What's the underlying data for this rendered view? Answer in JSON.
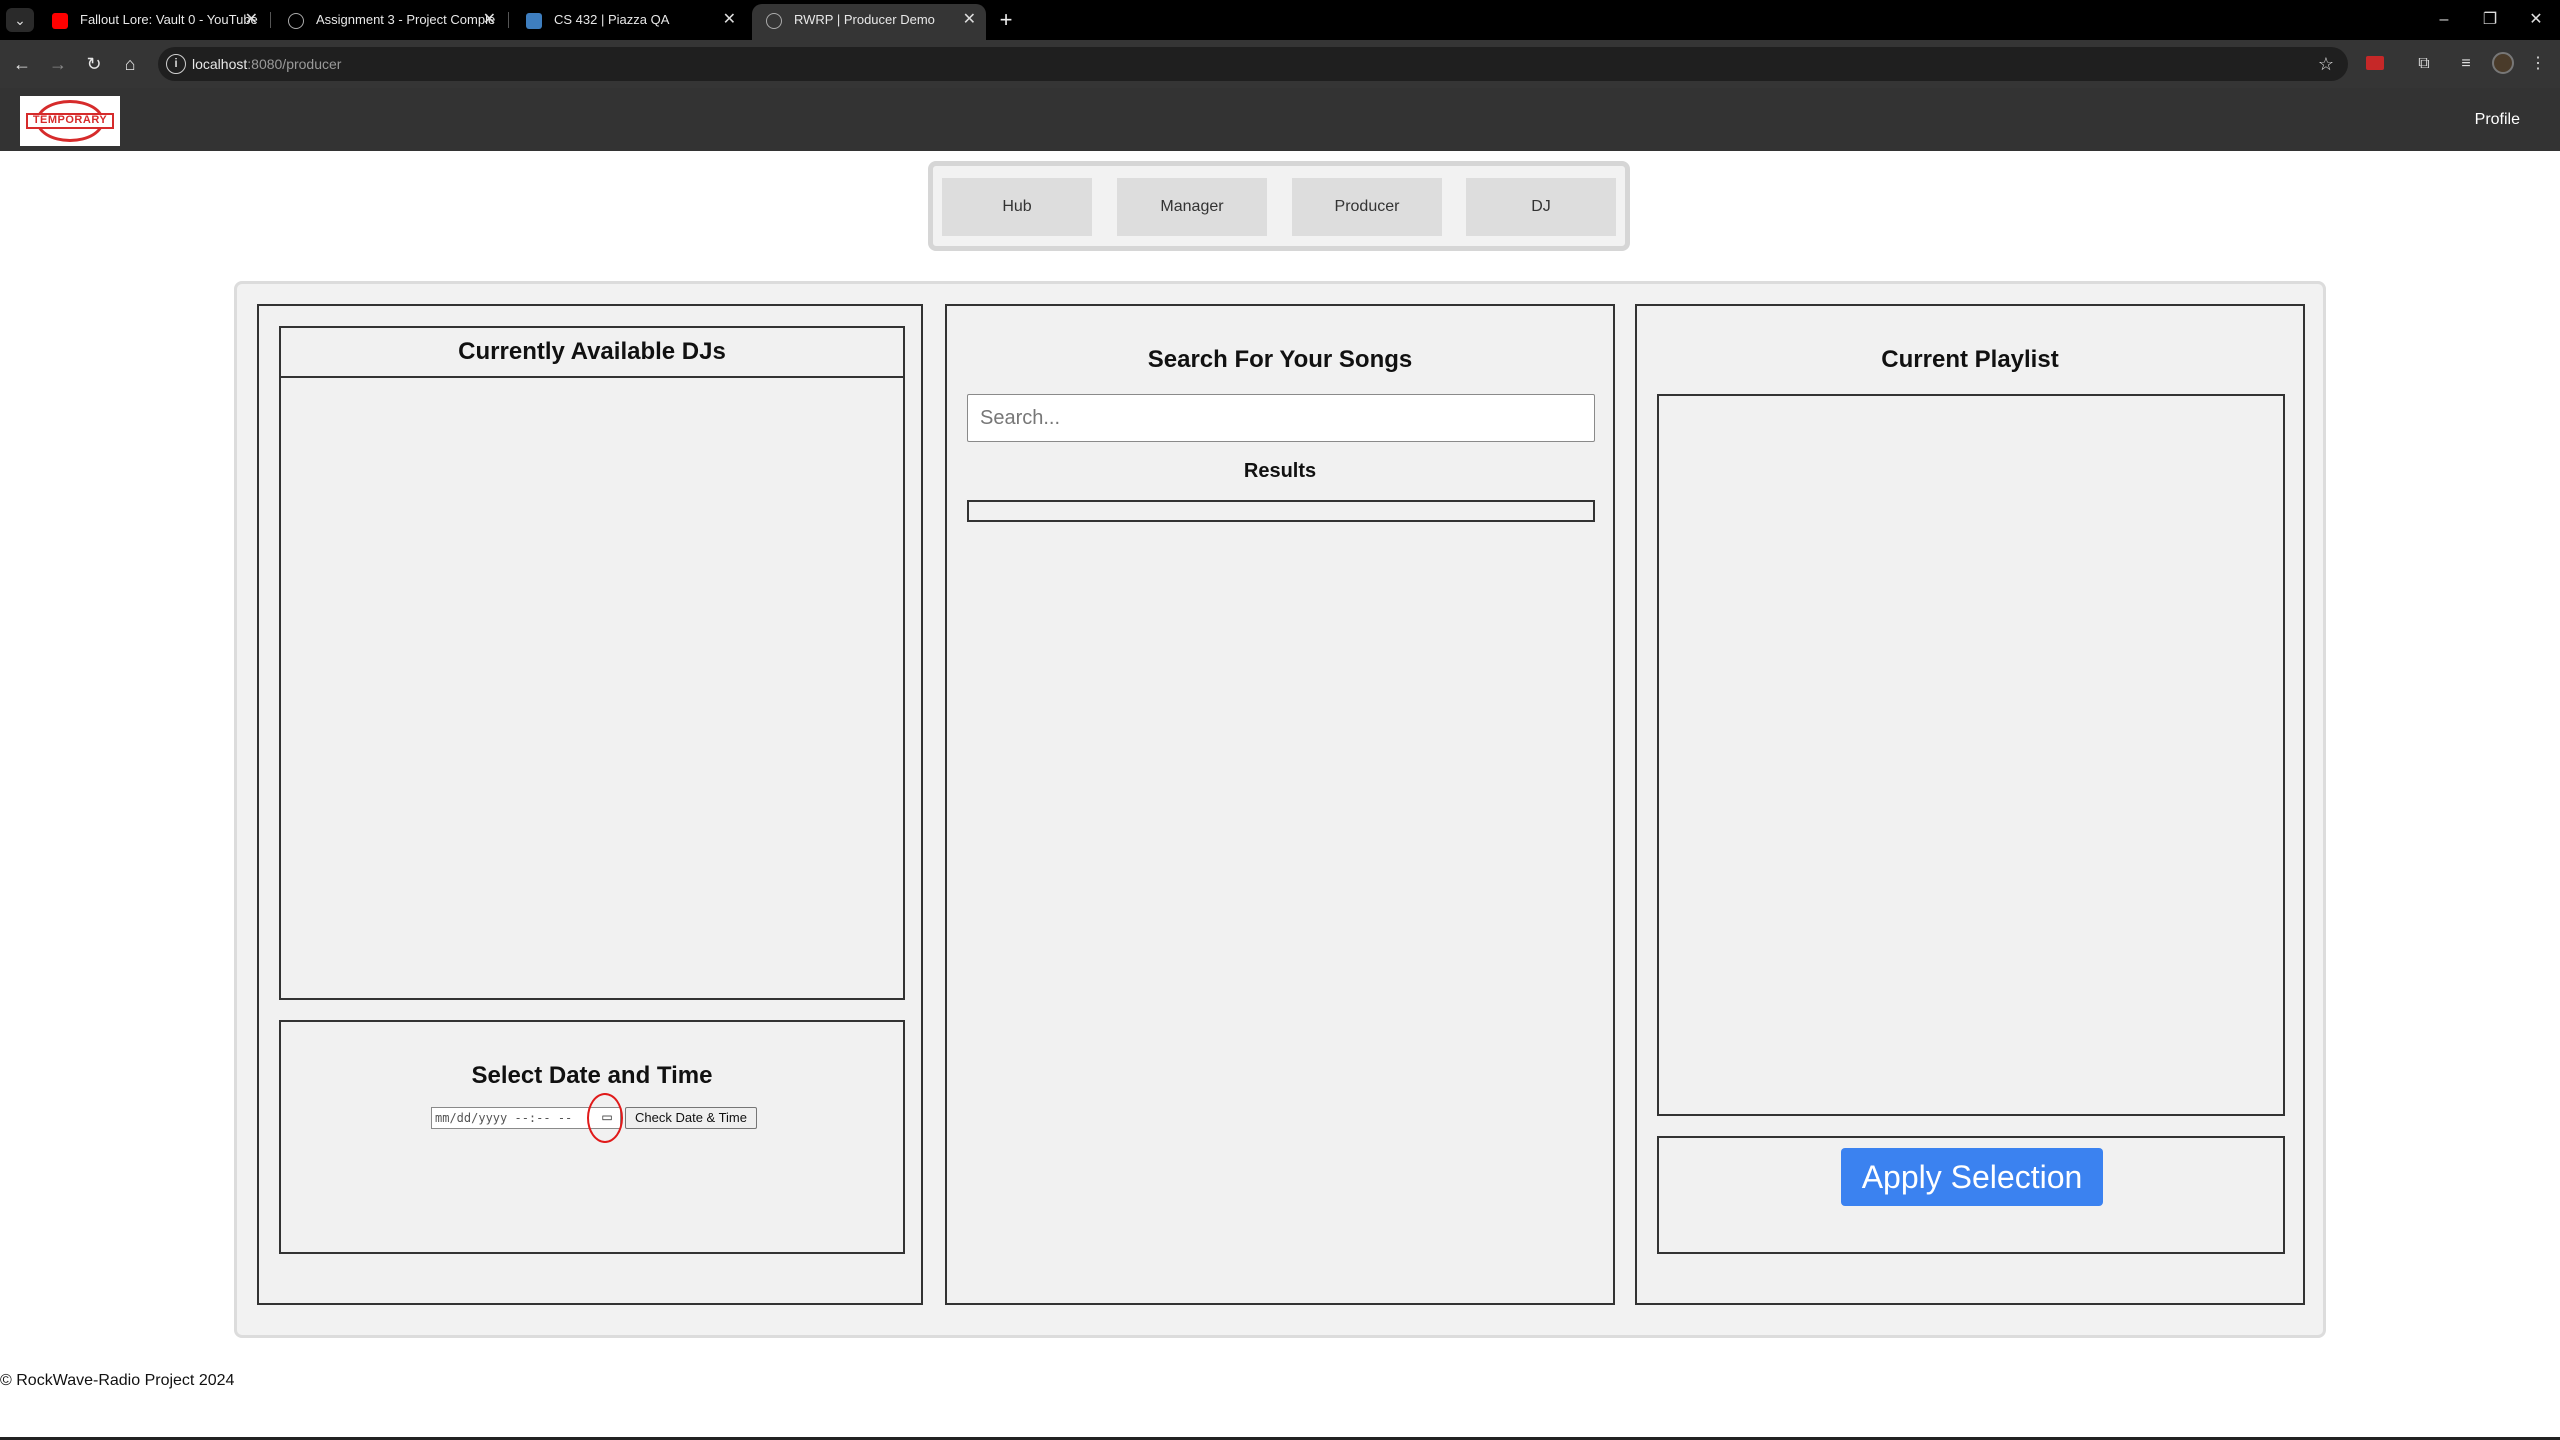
{
  "browser": {
    "tabs": [
      {
        "title": "Fallout Lore: Vault 0 - YouTube",
        "favicon": "youtube-icon"
      },
      {
        "title": "Assignment 3 - Project Comple",
        "favicon": "globe-icon"
      },
      {
        "title": "CS 432 | Piazza QA",
        "favicon": "piazza-icon"
      },
      {
        "title": "RWRP | Producer Demo",
        "favicon": "globe-icon",
        "active": true
      }
    ],
    "url_host": "localhost",
    "url_rest": ":8080/producer"
  },
  "header": {
    "logo_text": "TEMPORARY",
    "profile": "Profile"
  },
  "nav": {
    "tabs": [
      "Hub",
      "Manager",
      "Producer",
      "DJ"
    ]
  },
  "dj_panel": {
    "title": "Currently Available DJs"
  },
  "datetime": {
    "title": "Select Date and Time",
    "placeholder": "mm/dd/yyyy --:-- --",
    "check_button": "Check Date & Time"
  },
  "search": {
    "title": "Search For Your Songs",
    "placeholder": "Search...",
    "results_label": "Results"
  },
  "playlist": {
    "title": "Current Playlist",
    "apply_button": "Apply Selection"
  },
  "footer": {
    "text": "© RockWave-Radio Project 2024"
  },
  "colors": {
    "accent": "#3b82f0",
    "header_bg": "#333333",
    "highlight_circle": "#e01a1a"
  }
}
